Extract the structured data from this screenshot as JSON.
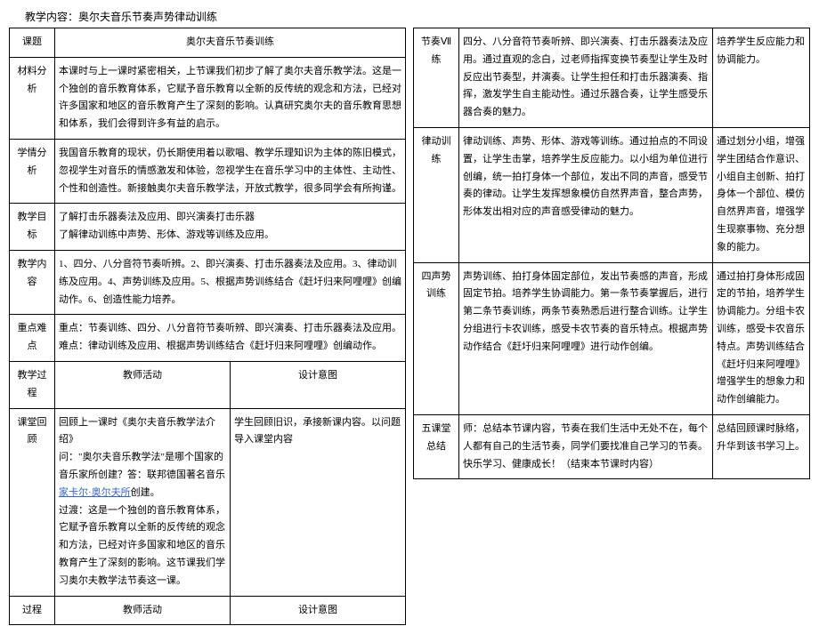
{
  "pageTitle": "教学内容：奥尔夫音乐节奏声势律动训练",
  "left": {
    "topicLabel": "课题",
    "topicValue": "奥尔夫音乐节奏训练",
    "materialLabel": "材料分析",
    "materialText": "本课时与上一课时紧密相关，上节课我们初步了解了奥尔夫音乐教学法。这是一个独创的音乐教育体系，它赋予音乐教育以全新的反传统的观念和方法，已经对许多国家和地区的音乐教育产生了深刻的影响。认真研究奥尔夫的音乐教育思想和体系，我们会得到许多有益的启示。",
    "learnLabel": "学情分析",
    "learnText": "我国音乐教育的现状，仍长期使用着以歌唱、教学乐理知识为主体的陈旧模式，忽视学生对音乐的情感激发和体验，忽视学生在音乐学习中的主体性、主动性、个性和创造性。新接触奥尔夫音乐教学法，开放式教学，很多同学会有所拘谨。",
    "goalLabel": "教学目标",
    "goalLine1": "了解打击乐器奏法及应用、即兴演奏打击乐器",
    "goalLine2": "了解律动训练中声势、形体、游戏等训练及应用。",
    "contentLabel": "教学内容",
    "contentText": "1、四分、八分音符节奏听辨。2、即兴演奏、打击乐器奏法及应用。3、律动训练及应用。4、声势训练及应用。5、根据声势训练结合《赶圩归来阿哩哩》创编动作。6、创造性能力培养。",
    "keyLabel": "重点难点",
    "keyText": "重点：节奏训练、四分、八分音符节奏听辨、即兴演奏、打击乐器奏法及应用。难点：律动训练及应用、根据声势训练结合《赶圩归来阿哩哩》创编动作。",
    "procLabel": "教学过程",
    "teacherActLabel": "教师活动",
    "designLabel": "设计意图",
    "reviewLabel": "课堂回顾",
    "reviewTeacherPre": "回顾上一课时《奥尔夫音乐教学法介绍》\n问：\"奥尔夫音乐教学法\"是哪个国家的音乐家所创建？答：联邦德国著名音乐",
    "reviewLink": "家卡尔·奥尔夫所",
    "reviewTeacherPost": "创建。\n过渡：这是一个独创的音乐教育体系，它赋予音乐教育以全新的反传统的观念和方法，已经对许多国家和地区的音乐教育产生了深刻的影响。这节课我们学习奥尔夫教学法节奏这一课。",
    "reviewDesign": "学生回顾旧识，承接新课内容。以问题导入课堂内容",
    "procLabel2": "过程",
    "teacherActLabel2": "教师活动",
    "designLabel2": "设计意图"
  },
  "right": {
    "r1Label": "节奏Ⅶ练",
    "r1Mid": "四分、八分音符节奏听辨、即兴演奏、打击乐器奏法及应用。通过直观的念白，过老师指挥变换节奏型让学生及时反应出节奏型，并演奏。让学生担任和打击乐器演奏、指挥，激发学生自主能动性。通过乐器合奏，让学生感受乐器合奏的魅力。",
    "r1Right": "培养学生反应能力和协调能力。",
    "r2Label": "律动训练",
    "r2Mid": "律动训练、声势、形体、游戏等训练。通过拍点的不同设置，让学生击掌，培养学生反应能力。以小组为单位进行创编，统一拍打身体一个部位，发出不同的声音，感受节奏的律动。让学生发挥想象模仿自然界声音，整合声势，形体发出相对应的声音感受律动的魅力。",
    "r2Right": "通过划分小组，增强学生团结合作意识、小组自主创新、拍打身体一个部位、模仿自然界声音，增强学生现察事物、充分想象的能力。",
    "r3Label": "四声势训练",
    "r3Mid": "声势训练、拍打身体固定部位，发出节奏感的声音，形成固定节拍。培养学生协调能力。第一条节奏掌握后，进行第二条节奏训练，两条节奏熟悉后进行整合训练。让学生分组进行卡农训练，感受卡农节奏的音乐特点。根据声势动作结合《赶圩归来阿哩哩》进行动作创编。",
    "r3Right": "通过拍打身体形成固定的节拍，培养学生协调能力。分组卡农训练，感受卡农音乐特点。声势训练结合《赶圩归来阿哩哩》增强学生的想象力和动作创编能力。",
    "r4Label": "五课堂总结",
    "r4Mid": "师：总结本节课内容，节奏在我们生活中无处不在，每个人都有自己的生活节奏，同学们要找准自己学习的节奏。快乐学习、健康成长！（结束本节课时内容）",
    "r4Right": "总结回顾课时脉络，升华到该书学习上。"
  }
}
